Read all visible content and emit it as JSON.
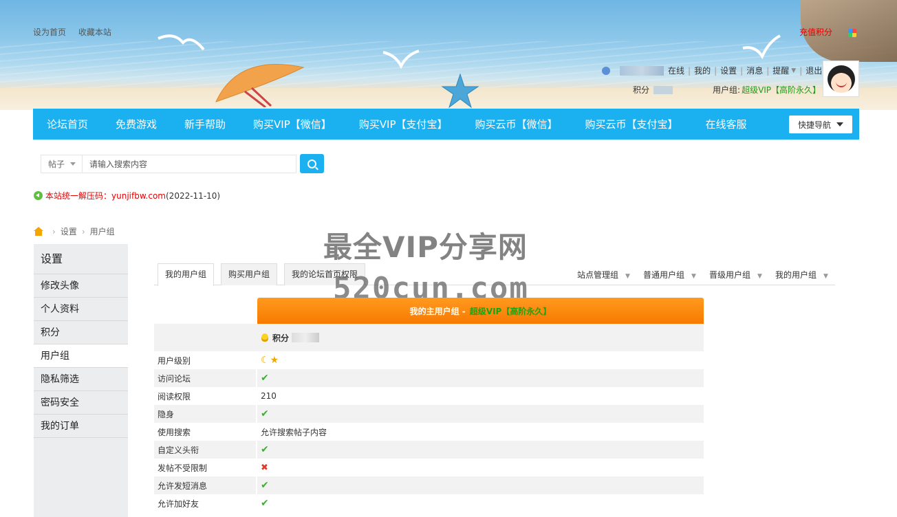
{
  "header": {
    "top_links": [
      "设为首页",
      "收藏本站"
    ],
    "recharge": "充值积分",
    "user_links": [
      "在线",
      "我的",
      "设置",
      "消息",
      "提醒",
      "退出"
    ],
    "score_label": "积分",
    "usergroup_label": "用户组:",
    "usergroup_value": "超级VIP【高阶永久】"
  },
  "nav": {
    "items": [
      "论坛首页",
      "免费游戏",
      "新手帮助",
      "购买VIP【微信】",
      "购买VIP【支付宝】",
      "购买云币【微信】",
      "购买云币【支付宝】",
      "在线客服"
    ],
    "quick_nav": "快捷导航"
  },
  "search": {
    "type": "帖子",
    "placeholder": "请输入搜索内容"
  },
  "notice": {
    "prefix": "本站统一解压码：",
    "code": "yunjifbw.com",
    "date": "(2022-11-10)"
  },
  "breadcrumb": [
    "设置",
    "用户组"
  ],
  "watermark": {
    "line1": "最全VIP分享网",
    "line2": "520cun.com"
  },
  "sidebar": {
    "title": "设置",
    "items": [
      "修改头像",
      "个人资料",
      "积分",
      "用户组",
      "隐私筛选",
      "密码安全",
      "我的订单"
    ],
    "active": "用户组"
  },
  "tabs": {
    "left": [
      "我的用户组",
      "购买用户组",
      "我的论坛首页权限"
    ],
    "right": [
      "站点管理组",
      "普通用户组",
      "晋级用户组",
      "我的用户组"
    ]
  },
  "group": {
    "head_label": "我的主用户组 -",
    "head_vip": "超级VIP【高阶永久】",
    "score_label": "积分",
    "rows": [
      {
        "label": "用户级别",
        "type": "level"
      },
      {
        "label": "访问论坛",
        "type": "yes"
      },
      {
        "label": "阅读权限",
        "type": "text",
        "value": "210"
      },
      {
        "label": "隐身",
        "type": "yes"
      },
      {
        "label": "使用搜索",
        "type": "text",
        "value": "允许搜索帖子内容"
      },
      {
        "label": "自定义头衔",
        "type": "yes"
      },
      {
        "label": "发帖不受限制",
        "type": "no"
      },
      {
        "label": "允许发短消息",
        "type": "yes"
      },
      {
        "label": "允许加好友",
        "type": "yes"
      }
    ]
  },
  "colors": {
    "accent": "#1bb1f0",
    "orange": "#f77a00",
    "vip_green": "#16a516",
    "red": "#e40000"
  }
}
